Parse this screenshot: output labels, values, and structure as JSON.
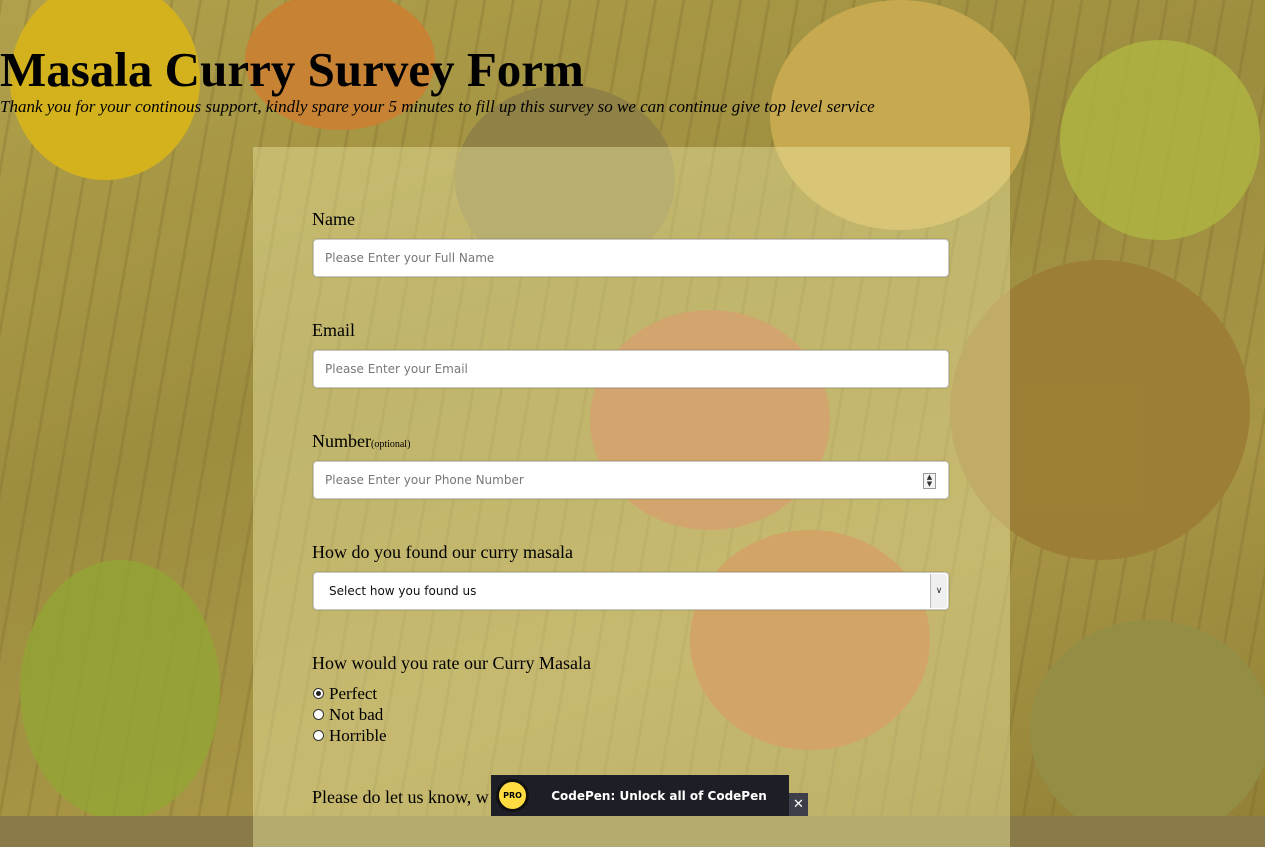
{
  "header": {
    "title": "Masala Curry Survey Form",
    "subtitle": "Thank you for your continous support, kindly spare your 5 minutes to fill up this survey so we can continue give top level service"
  },
  "form": {
    "name": {
      "label": "Name",
      "placeholder": "Please Enter your Full Name"
    },
    "email": {
      "label": "Email",
      "placeholder": "Please Enter your Email"
    },
    "number": {
      "label": "Number",
      "optional": "(optional)",
      "placeholder": "Please Enter your Phone Number"
    },
    "found": {
      "label": "How do you found our curry masala",
      "selected": "Select how you found us"
    },
    "rating": {
      "label": "How would you rate our Curry Masala",
      "options": [
        "Perfect",
        "Not bad",
        "Horrible"
      ],
      "selected": "Perfect"
    },
    "feedback": {
      "label_visible": "Please do let us know, w"
    }
  },
  "banner": {
    "badge": "PRO",
    "text": "CodePen: Unlock all of CodePen",
    "close": "✕"
  },
  "icons": {
    "spinner": "number-spinner-icon",
    "select_arrow": "chevron-down-icon",
    "close": "close-icon"
  }
}
